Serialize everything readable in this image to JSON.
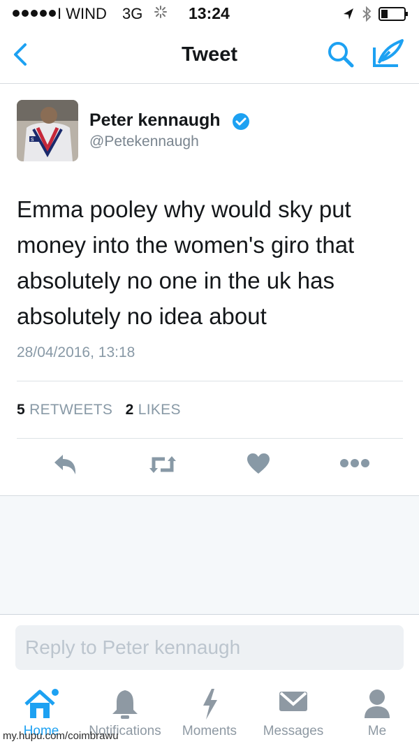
{
  "status_bar": {
    "carrier": "I WIND",
    "network": "3G",
    "time": "13:24"
  },
  "nav": {
    "title": "Tweet",
    "back_icon": "chevron-left-icon",
    "search_icon": "search-icon",
    "compose_icon": "compose-icon"
  },
  "tweet": {
    "author_name": "Peter kennaugh",
    "handle": "@Petekennaugh",
    "text": "Emma pooley why would sky put money into the women's giro that absolutely no one in the uk has absolutely no idea about",
    "timestamp": "28/04/2016, 13:18",
    "retweets_count": "5",
    "retweets_label": "RETWEETS",
    "likes_count": "2",
    "likes_label": "LIKES"
  },
  "reply": {
    "placeholder": "Reply to Peter kennaugh"
  },
  "tabs": [
    {
      "label": "Home",
      "icon": "home-icon",
      "active": true
    },
    {
      "label": "Notifications",
      "icon": "bell-icon",
      "active": false
    },
    {
      "label": "Moments",
      "icon": "lightning-icon",
      "active": false
    },
    {
      "label": "Messages",
      "icon": "envelope-icon",
      "active": false
    },
    {
      "label": "Me",
      "icon": "person-icon",
      "active": false
    }
  ],
  "watermark": "my.hupu.com/coimbrawu",
  "colors": {
    "accent": "#1da1f2",
    "text": "#14171a",
    "muted": "#8899a6"
  }
}
